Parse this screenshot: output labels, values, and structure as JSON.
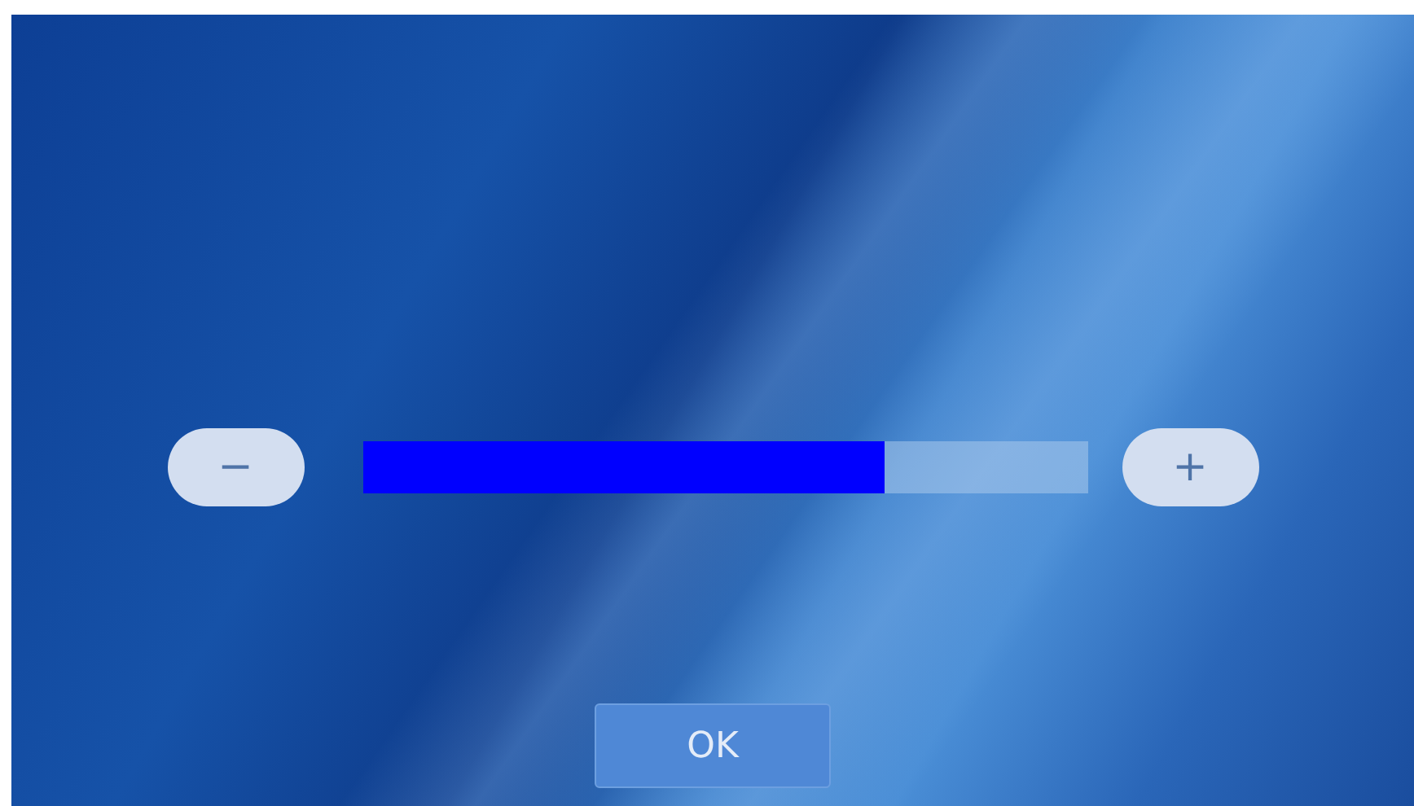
{
  "slider": {
    "decrease_label": "−",
    "increase_label": "+",
    "level": 0.72
  },
  "buttons": [
    "OK"
  ]
}
